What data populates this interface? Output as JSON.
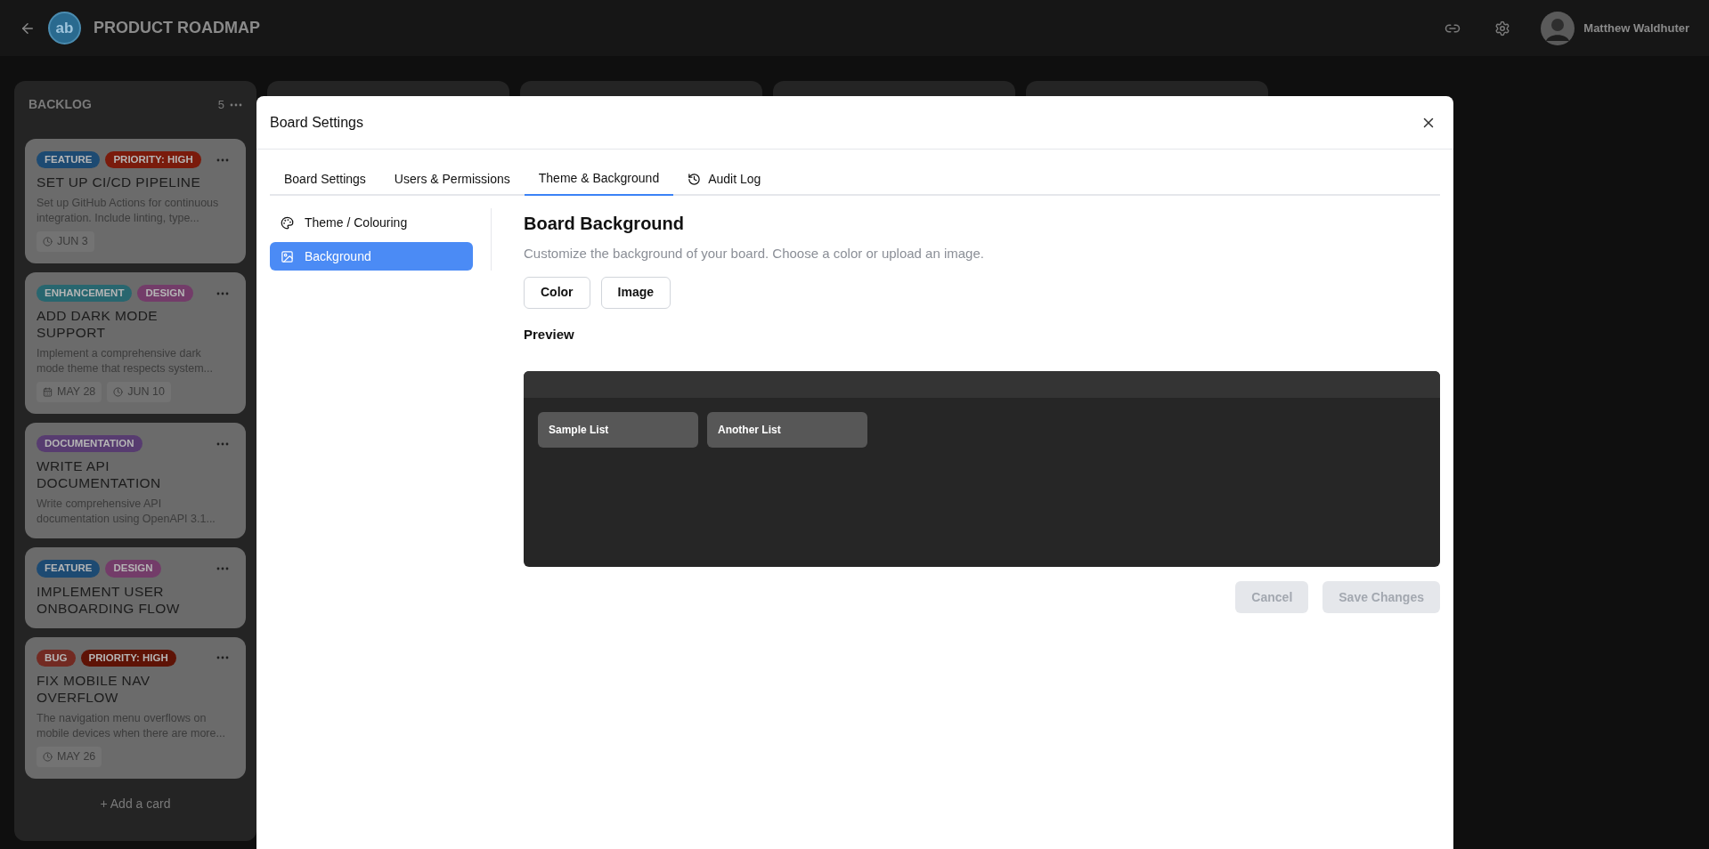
{
  "header": {
    "title": "PRODUCT ROADMAP",
    "logo": "ab",
    "user": "Matthew Waldhuter"
  },
  "board": {
    "columns": [
      {
        "title": "BACKLOG",
        "count": "5",
        "add_label": "+ Add a card",
        "cards": [
          {
            "tags": [
              {
                "label": "FEATURE",
                "color": "#1d4a72"
              },
              {
                "label": "PRIORITY: HIGH",
                "color": "#7a1b0c"
              }
            ],
            "title": "SET UP CI/CD PIPELINE",
            "description": "Set up GitHub Actions for continuous integration. Include linting, type...",
            "dates": [
              {
                "kind": "due",
                "label": "JUN 3"
              }
            ]
          },
          {
            "tags": [
              {
                "label": "ENHANCEMENT",
                "color": "#28666f"
              },
              {
                "label": "DESIGN",
                "color": "#733c69"
              }
            ],
            "title": "ADD DARK MODE SUPPORT",
            "description": "Implement a comprehensive dark mode theme that respects system...",
            "dates": [
              {
                "kind": "start",
                "label": "MAY 28"
              },
              {
                "kind": "due",
                "label": "JUN 10"
              }
            ]
          },
          {
            "tags": [
              {
                "label": "DOCUMENTATION",
                "color": "#573c70"
              }
            ],
            "title": "WRITE API DOCUMENTATION",
            "description": "Write comprehensive API documentation using OpenAPI 3.1..."
          },
          {
            "tags": [
              {
                "label": "FEATURE",
                "color": "#1d4a72"
              },
              {
                "label": "DESIGN",
                "color": "#733c69"
              }
            ],
            "title": "IMPLEMENT USER ONBOARDING FLOW"
          },
          {
            "tags": [
              {
                "label": "BUG",
                "color": "#722a22"
              },
              {
                "label": "PRIORITY: HIGH",
                "color": "#5e1306"
              }
            ],
            "title": "FIX MOBILE NAV OVERFLOW",
            "description": "The navigation menu overflows on mobile devices when there are more...",
            "dates": [
              {
                "kind": "due",
                "label": "MAY 26"
              }
            ]
          }
        ]
      },
      {},
      {},
      {},
      {}
    ]
  },
  "dialog": {
    "title": "Board Settings",
    "tabs": [
      {
        "label": "Board Settings",
        "selected": false
      },
      {
        "label": "Users & Permissions",
        "selected": false
      },
      {
        "label": "Theme & Background",
        "selected": true
      },
      {
        "label": "Audit Log",
        "selected": false
      }
    ],
    "sidebar": [
      {
        "label": "Theme / Colouring",
        "selected": false
      },
      {
        "label": "Background",
        "selected": true
      }
    ],
    "heading": "Board Background",
    "description": "Customize the background of your board. Choose a color or upload an image.",
    "source_buttons": [
      "Color",
      "Image"
    ],
    "preview_label": "Preview",
    "preview_lists": [
      "Sample List",
      "Another List"
    ],
    "actions": [
      {
        "label": "Cancel",
        "disabled": true
      },
      {
        "label": "Save Changes",
        "disabled": true
      }
    ]
  }
}
